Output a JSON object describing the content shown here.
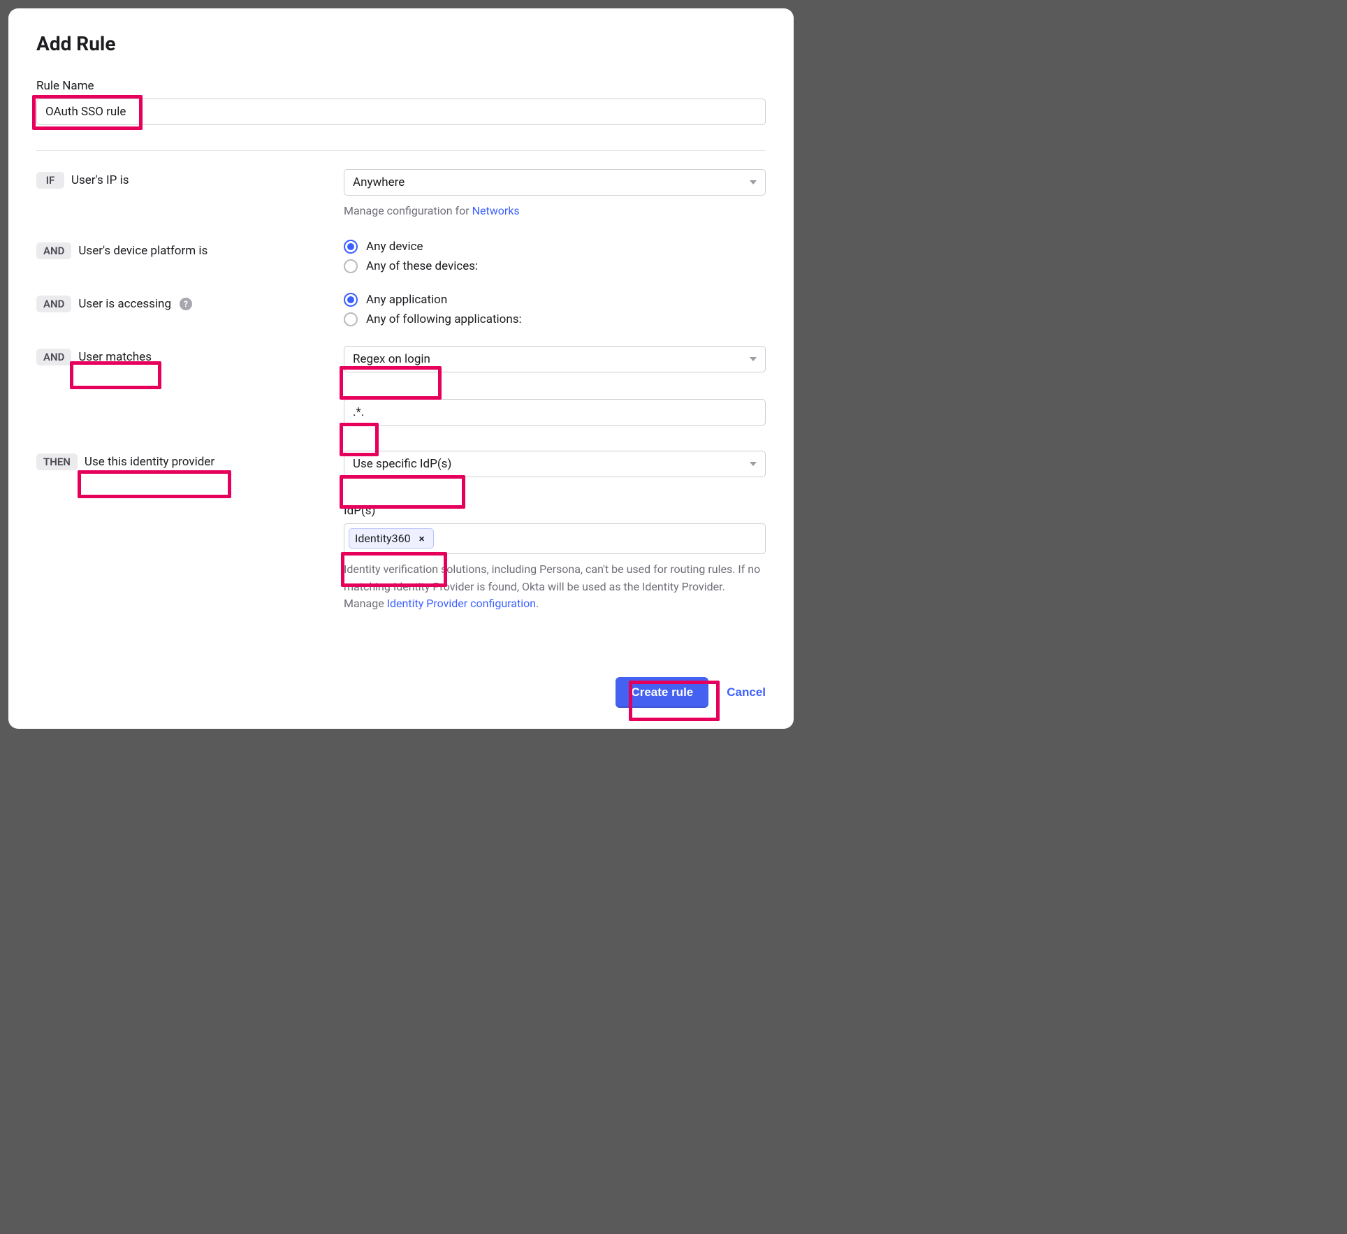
{
  "modal": {
    "title": "Add Rule",
    "rule_name_label": "Rule Name",
    "rule_name_value": "OAuth SSO rule"
  },
  "pills": {
    "if": "IF",
    "and": "AND",
    "then": "THEN"
  },
  "cond": {
    "ip_label": "User's IP is",
    "ip_select": "Anywhere",
    "ip_helper_prefix": "Manage configuration for ",
    "ip_helper_link": "Networks",
    "device_label": "User's device platform is",
    "device_opt1": "Any device",
    "device_opt2": "Any of these devices:",
    "access_label": "User is accessing",
    "access_opt1": "Any application",
    "access_opt2": "Any of following applications:",
    "match_label": "User matches",
    "match_select": "Regex on login",
    "match_value": ".*."
  },
  "then": {
    "label": "Use this identity provider",
    "select": "Use specific IdP(s)",
    "idp_label": "IdP(s)",
    "idp_tag": "Identity360",
    "helper": "Identity verification solutions, including Persona, can't be used for routing rules. If no matching Identity Provider is found, Okta will be used as the Identity Provider. Manage ",
    "helper_link": "Identity Provider configuration",
    "helper_suffix": "."
  },
  "footer": {
    "create": "Create rule",
    "cancel": "Cancel"
  }
}
